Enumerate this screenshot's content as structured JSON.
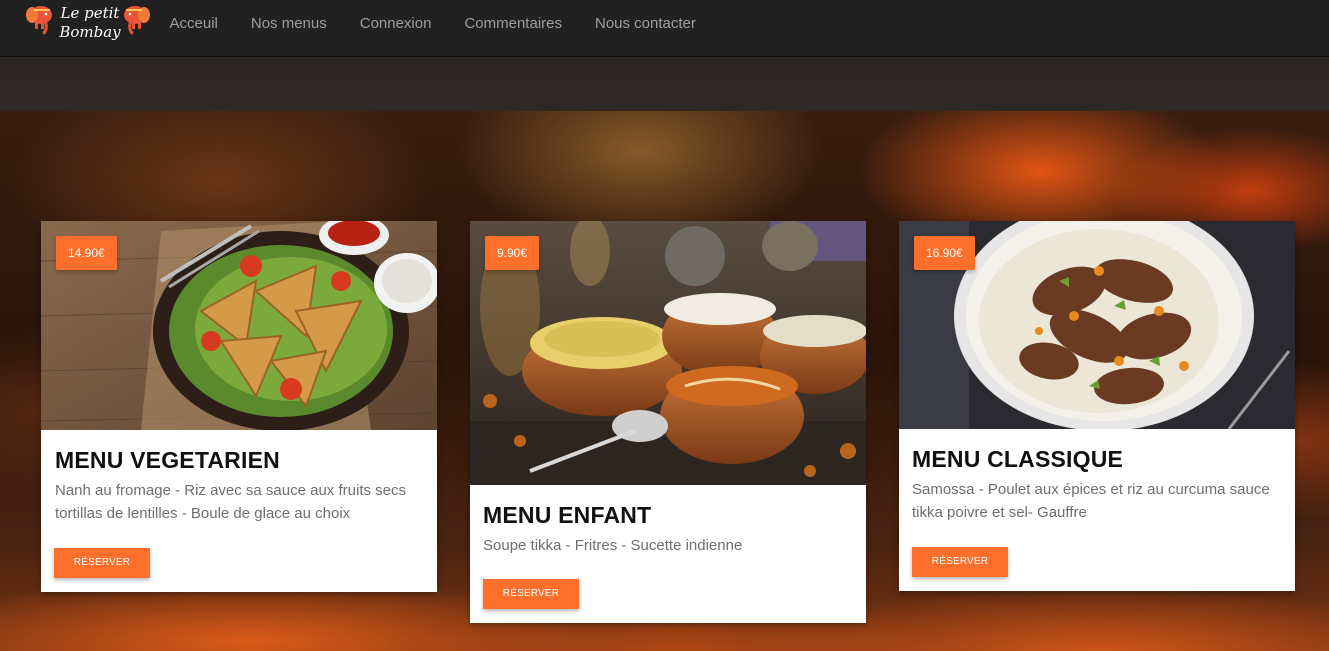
{
  "brand": {
    "line1": "Le petit",
    "line2": "Bombay",
    "logo_icon": "elephant-icon"
  },
  "nav": {
    "items": [
      {
        "label": "Acceuil"
      },
      {
        "label": "Nos menus"
      },
      {
        "label": "Connexion"
      },
      {
        "label": "Commentaires"
      },
      {
        "label": "Nous contacter"
      }
    ]
  },
  "colors": {
    "accent": "#ff6f2c",
    "navbar": "#212121",
    "title": "#111111",
    "text": "#6e6e6e"
  },
  "menus": [
    {
      "price": "14.90€",
      "title": "MENU VEGETARIEN",
      "description": "Nanh au fromage - Riz avec sa sauce aux fruits secs tortillas de lentilles - Boule de glace au choix",
      "button": "RÉSERVER"
    },
    {
      "price": "9.90€",
      "title": "MENU ENFANT",
      "description": "Soupe tikka - Fritres - Sucette indienne",
      "button": "RÉSERVER"
    },
    {
      "price": "16.90€",
      "title": "MENU CLASSIQUE",
      "description": "Samossa - Poulet aux épices et riz au curcuma sauce tikka poivre et sel- Gauffre",
      "button": "RÉSERVER"
    }
  ]
}
